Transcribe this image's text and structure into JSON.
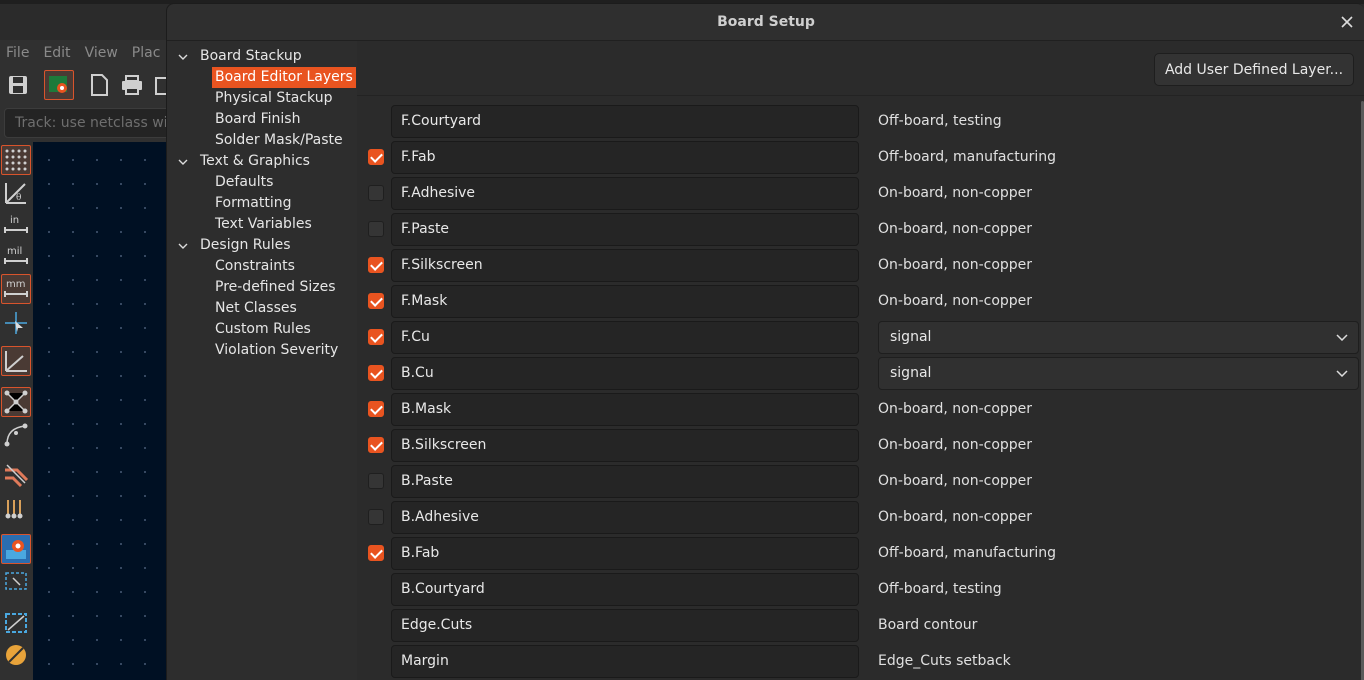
{
  "app": {
    "menu": [
      "File",
      "Edit",
      "View",
      "Plac"
    ],
    "track_placeholder": "Track: use netclass wid",
    "left_toolbar_icons": [
      "grid-icon",
      "polar-coords-icon",
      "inch-units-icon",
      "mil-units-icon",
      "mm-units-icon",
      "full-crosshair-icon",
      "angle-snap-icon",
      "ratsnest-icon",
      "curved-ratsnest-icon",
      "track-display-icon",
      "via-display-icon",
      "high-contrast-icon",
      "selection-filter-icon",
      "zone-fill-icon",
      "design-rule-icon"
    ],
    "toolbar_icons": [
      "save-icon",
      "board-setup-icon",
      "page-settings-icon",
      "print-icon",
      "plot-icon"
    ]
  },
  "dialog": {
    "title": "Board Setup",
    "close_icon": "close-icon",
    "add_button": "Add User Defined Layer...",
    "tree": [
      {
        "label": "Board Stackup",
        "level": 0,
        "expanded": true
      },
      {
        "label": "Board Editor Layers",
        "level": 1,
        "selected": true
      },
      {
        "label": "Physical Stackup",
        "level": 1
      },
      {
        "label": "Board Finish",
        "level": 1
      },
      {
        "label": "Solder Mask/Paste",
        "level": 1
      },
      {
        "label": "Text & Graphics",
        "level": 0,
        "expanded": true
      },
      {
        "label": "Defaults",
        "level": 1
      },
      {
        "label": "Formatting",
        "level": 1
      },
      {
        "label": "Text Variables",
        "level": 1
      },
      {
        "label": "Design Rules",
        "level": 0,
        "expanded": true
      },
      {
        "label": "Constraints",
        "level": 1
      },
      {
        "label": "Pre-defined Sizes",
        "level": 1
      },
      {
        "label": "Net Classes",
        "level": 1
      },
      {
        "label": "Custom Rules",
        "level": 1
      },
      {
        "label": "Violation Severity",
        "level": 1
      }
    ],
    "layers": [
      {
        "name": "F.Courtyard",
        "checkbox": "none",
        "type": "Off-board, testing",
        "select": false
      },
      {
        "name": "F.Fab",
        "checkbox": "checked",
        "type": "Off-board, manufacturing",
        "select": false
      },
      {
        "name": "F.Adhesive",
        "checkbox": "unchecked",
        "type": "On-board, non-copper",
        "select": false
      },
      {
        "name": "F.Paste",
        "checkbox": "unchecked",
        "type": "On-board, non-copper",
        "select": false
      },
      {
        "name": "F.Silkscreen",
        "checkbox": "checked",
        "type": "On-board, non-copper",
        "select": false
      },
      {
        "name": "F.Mask",
        "checkbox": "checked",
        "type": "On-board, non-copper",
        "select": false
      },
      {
        "name": "F.Cu",
        "checkbox": "checked",
        "type": "signal",
        "select": true
      },
      {
        "name": "B.Cu",
        "checkbox": "checked",
        "type": "signal",
        "select": true
      },
      {
        "name": "B.Mask",
        "checkbox": "checked",
        "type": "On-board, non-copper",
        "select": false
      },
      {
        "name": "B.Silkscreen",
        "checkbox": "checked",
        "type": "On-board, non-copper",
        "select": false
      },
      {
        "name": "B.Paste",
        "checkbox": "unchecked",
        "type": "On-board, non-copper",
        "select": false
      },
      {
        "name": "B.Adhesive",
        "checkbox": "unchecked",
        "type": "On-board, non-copper",
        "select": false
      },
      {
        "name": "B.Fab",
        "checkbox": "checked",
        "type": "Off-board, manufacturing",
        "select": false
      },
      {
        "name": "B.Courtyard",
        "checkbox": "none",
        "type": "Off-board, testing",
        "select": false
      },
      {
        "name": "Edge.Cuts",
        "checkbox": "none",
        "type": "Board contour",
        "select": false
      },
      {
        "name": "Margin",
        "checkbox": "none",
        "type": "Edge_Cuts setback",
        "select": false
      }
    ]
  },
  "colors": {
    "accent": "#e95420",
    "canvas": "#001023"
  }
}
